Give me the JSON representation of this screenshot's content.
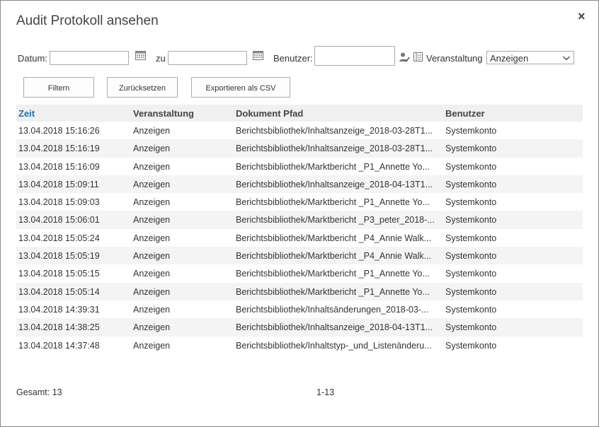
{
  "dialog": {
    "title": "Audit Protokoll ansehen",
    "close_label": "×"
  },
  "filters": {
    "date_label": "Datum:",
    "to_label": "zu",
    "user_label": "Benutzer:",
    "event_label": "Veranstaltung",
    "event_selected": "Anzeigen",
    "date_from_value": "",
    "date_to_value": "",
    "user_value": ""
  },
  "buttons": {
    "filter": "Filtern",
    "reset": "Zurücksetzen",
    "export": "Exportieren als CSV"
  },
  "table": {
    "headers": [
      "Zeit",
      "Veranstaltung",
      "Dokument Pfad",
      "Benutzer"
    ],
    "rows": [
      [
        "13.04.2018 15:16:26",
        "Anzeigen",
        "Berichtsbibliothek/Inhaltsanzeige_2018-03-28T1...",
        "Systemkonto"
      ],
      [
        "13.04.2018 15:16:19",
        "Anzeigen",
        "Berichtsbibliothek/Inhaltsanzeige_2018-03-28T1...",
        "Systemkonto"
      ],
      [
        "13.04.2018 15:16:09",
        "Anzeigen",
        "Berichtsbibliothek/Marktbericht _P1_Annette Yo...",
        "Systemkonto"
      ],
      [
        "13.04.2018 15:09:11",
        "Anzeigen",
        "Berichtsbibliothek/Inhaltsanzeige_2018-04-13T1...",
        "Systemkonto"
      ],
      [
        "13.04.2018 15:09:03",
        "Anzeigen",
        "Berichtsbibliothek/Marktbericht _P1_Annette Yo...",
        "Systemkonto"
      ],
      [
        "13.04.2018 15:06:01",
        "Anzeigen",
        "Berichtsbibliothek/Marktbericht _P3_peter_2018-...",
        "Systemkonto"
      ],
      [
        "13.04.2018 15:05:24",
        "Anzeigen",
        "Berichtsbibliothek/Marktbericht _P4_Annie Walk...",
        "Systemkonto"
      ],
      [
        "13.04.2018 15:05:19",
        "Anzeigen",
        "Berichtsbibliothek/Marktbericht _P4_Annie Walk...",
        "Systemkonto"
      ],
      [
        "13.04.2018 15:05:15",
        "Anzeigen",
        "Berichtsbibliothek/Marktbericht _P1_Annette Yo...",
        "Systemkonto"
      ],
      [
        "13.04.2018 15:05:14",
        "Anzeigen",
        "Berichtsbibliothek/Marktbericht _P1_Annette Yo...",
        "Systemkonto"
      ],
      [
        "13.04.2018 14:39:31",
        "Anzeigen",
        "Berichtsbibliothek/Inhaltsänderungen_2018-03-...",
        "Systemkonto"
      ],
      [
        "13.04.2018 14:38:25",
        "Anzeigen",
        "Berichtsbibliothek/Inhaltsanzeige_2018-04-13T1...",
        "Systemkonto"
      ],
      [
        "13.04.2018 14:37:48",
        "Anzeigen",
        "Berichtsbibliothek/Inhaltstyp-_und_Listenänderu...",
        "Systemkonto"
      ]
    ]
  },
  "footer": {
    "total": "Gesamt: 13",
    "pager": "1-13"
  },
  "colors": {
    "link": "#1f6fb5",
    "header_bg": "#f0f0f0"
  },
  "icons": {
    "calendar": "calendar-icon",
    "people_picker": "people-picker-icon",
    "address_book": "address-book-icon",
    "dropdown": "chevron-down-icon"
  }
}
